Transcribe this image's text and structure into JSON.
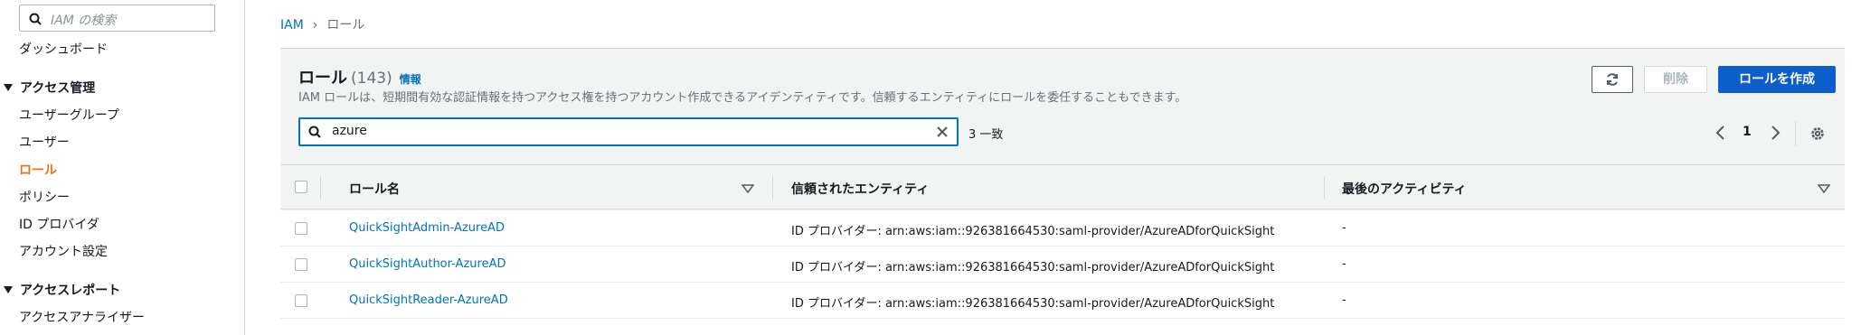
{
  "sidebar": {
    "search_placeholder": "IAM の検索",
    "dashboard": "ダッシュボード",
    "access_management": "アクセス管理",
    "items": [
      "ユーザーグループ",
      "ユーザー",
      "ロール",
      "ポリシー",
      "ID プロバイダ",
      "アカウント設定"
    ],
    "active_item": "ロール",
    "access_reports": "アクセスレポート",
    "report_items": [
      "アクセスアナライザー"
    ]
  },
  "breadcrumb": {
    "root": "IAM",
    "separator": "›",
    "current": "ロール"
  },
  "panel": {
    "title": "ロール",
    "count": "(143)",
    "info": "情報",
    "description": "IAM ロールは、短期間有効な認証情報を持つアクセス権を持つアカウント作成できるアイデンティティです。信頼するエンティティにロールを委任することもできます。",
    "buttons": {
      "refresh_icon": "refresh-icon",
      "delete": "削除",
      "create": "ロールを作成"
    },
    "filter": {
      "value": "azure",
      "matches": "3 一致"
    },
    "pagination": {
      "page": "1"
    }
  },
  "table": {
    "columns": [
      "ロール名",
      "信頼されたエンティティ",
      "最後のアクティビティ"
    ],
    "rows": [
      {
        "name": "QuickSightAdmin-AzureAD",
        "entity": "ID プロバイダー: arn:aws:iam::926381664530:saml-provider/AzureADforQuickSight",
        "activity": "-"
      },
      {
        "name": "QuickSightAuthor-AzureAD",
        "entity": "ID プロバイダー: arn:aws:iam::926381664530:saml-provider/AzureADforQuickSight",
        "activity": "-"
      },
      {
        "name": "QuickSightReader-AzureAD",
        "entity": "ID プロバイダー: arn:aws:iam::926381664530:saml-provider/AzureADforQuickSight",
        "activity": "-"
      }
    ]
  },
  "colors": {
    "accent": "#ec7211",
    "link": "#0073bb",
    "primary_button": "#0b5ecb"
  }
}
